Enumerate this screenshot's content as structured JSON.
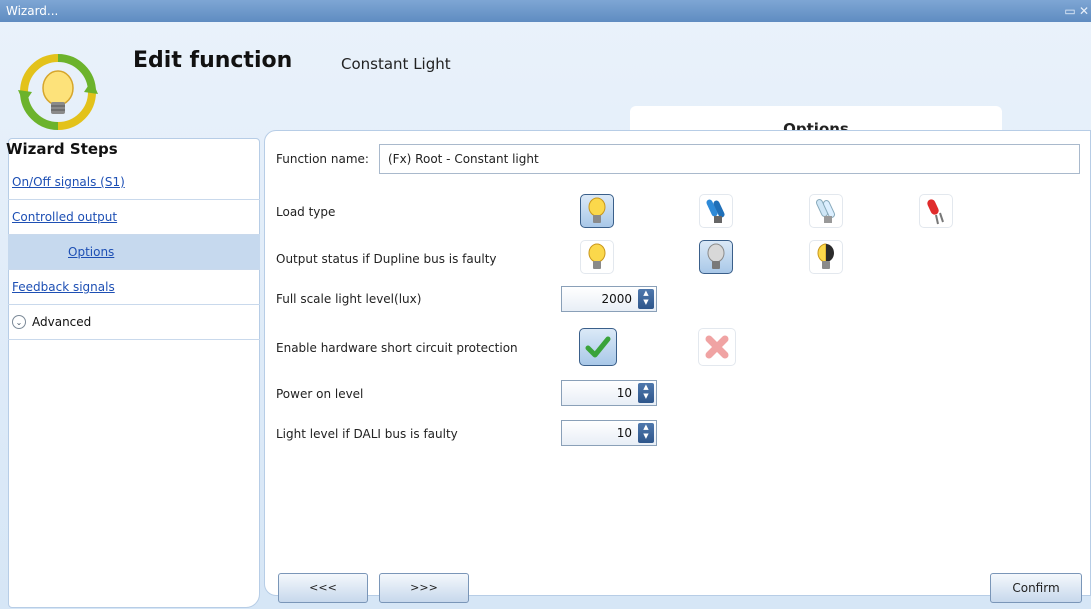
{
  "window": {
    "title": "Wizard...",
    "minimize_glyph": "▭",
    "close_glyph": "✕"
  },
  "header": {
    "title": "Edit function",
    "subtitle": "Constant Light",
    "tab": "Options"
  },
  "sidebar": {
    "heading": "Wizard Steps",
    "items": [
      {
        "label": "On/Off signals (S1)"
      },
      {
        "label": "Controlled output"
      },
      {
        "label": "Options",
        "active": true
      },
      {
        "label": "Feedback signals"
      }
    ],
    "advanced": {
      "label": "Advanced",
      "icon": "chevron-down-icon"
    }
  },
  "form": {
    "function_name_label": "Function name:",
    "function_name_value": "(Fx) Root - Constant light",
    "load_type_label": "Load type",
    "load_type_options": [
      "incandescent-bulb-icon",
      "blue-tube-icon",
      "cfl-icon",
      "red-led-icon"
    ],
    "load_type_selected": 0,
    "bus_fault_label": "Output status if Dupline bus is faulty",
    "bus_fault_options": [
      "bulb-on-icon",
      "bulb-off-icon",
      "bulb-half-icon"
    ],
    "bus_fault_selected": 1,
    "full_scale_label": "Full scale  light level(lux)",
    "full_scale_value": "2000",
    "short_circuit_label": "Enable hardware short circuit protection",
    "short_circuit_enabled": true,
    "power_on_label": "Power on level",
    "power_on_value": "10",
    "dali_fault_label": "Light level if DALI bus is faulty",
    "dali_fault_value": "10"
  },
  "footer": {
    "prev_label": "<<<",
    "next_label": ">>>",
    "confirm_label": "Confirm"
  },
  "colors": {
    "titlebar": "#6b96c8",
    "link": "#1d4fb4",
    "selected_bg": "#c6d9ee",
    "check_green": "#3aa33a",
    "cross_red": "#e27a7a"
  }
}
